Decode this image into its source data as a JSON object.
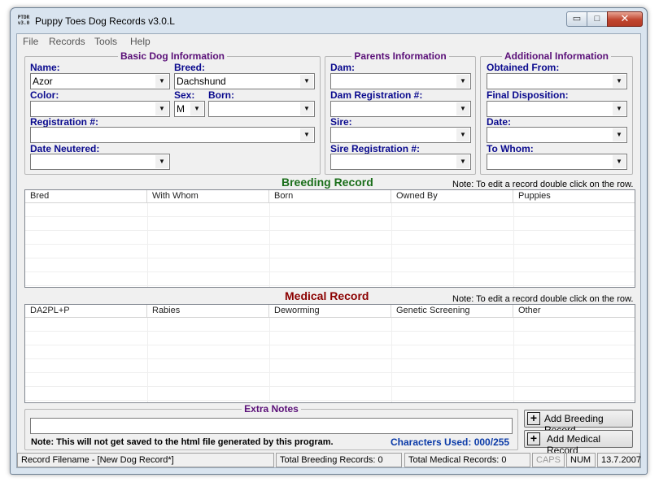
{
  "window": {
    "title": "Puppy Toes Dog Records v3.0.L",
    "icon_text": "PTDR v3.0",
    "controls": {
      "minimize": "▭",
      "maximize": "□",
      "close": "✕"
    }
  },
  "menu": [
    "File",
    "Records",
    "Tools",
    "Help"
  ],
  "basic_info": {
    "title": "Basic Dog Information",
    "name_label": "Name:",
    "name_value": "Azor",
    "breed_label": "Breed:",
    "breed_value": "Dachshund",
    "color_label": "Color:",
    "color_value": "",
    "sex_label": "Sex:",
    "sex_value": "M",
    "born_label": "Born:",
    "born_value": "",
    "registration_label": "Registration #:",
    "registration_value": "",
    "neutered_label": "Date Neutered:",
    "neutered_value": ""
  },
  "parents_info": {
    "title": "Parents Information",
    "dam_label": "Dam:",
    "dam_reg_label": "Dam Registration #:",
    "sire_label": "Sire:",
    "sire_reg_label": "Sire Registration #:"
  },
  "additional_info": {
    "title": "Additional Information",
    "obtained_label": "Obtained From:",
    "final_label": "Final Disposition:",
    "date_label": "Date:",
    "whom_label": "To Whom:"
  },
  "breeding": {
    "title": "Breeding Record",
    "note": "Note: To edit a record double click on the row.",
    "columns": [
      "Bred",
      "With Whom",
      "Born",
      "Owned By",
      "Puppies"
    ],
    "title_color": "#1a6e1a"
  },
  "medical": {
    "title": "Medical Record",
    "note": "Note: To edit a record double click on the row.",
    "columns": [
      "DA2PL+P",
      "Rabies",
      "Deworming",
      "Genetic Screening",
      "Other"
    ],
    "title_color": "#8b0000"
  },
  "extra_notes": {
    "title": "Extra Notes",
    "value": "",
    "warning": "Note:  This will not get saved to the html file generated by this program.",
    "chars_used": "Characters Used: 000/255"
  },
  "buttons": {
    "add_breeding": "Add Breeding Record",
    "add_medical": "Add Medical Record"
  },
  "status": {
    "filename": "Record Filename - [New Dog Record*]",
    "total_breeding": "Total Breeding Records: 0",
    "total_medical": "Total Medical Records: 0",
    "caps": "CAPS",
    "num": "NUM",
    "date": "13.7.2007"
  }
}
